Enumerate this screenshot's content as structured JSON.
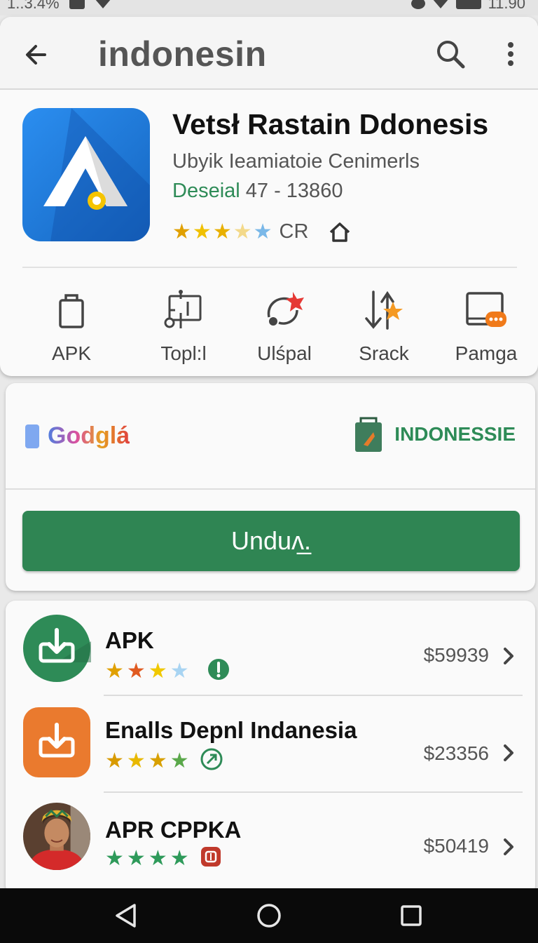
{
  "status_bar": {
    "left_text": "1..3.4%",
    "right_text": "11.90"
  },
  "app_bar": {
    "title": "indonesin"
  },
  "app": {
    "title": "Vetsł Rastain Ddonesis",
    "developer": "Ubyik Ieamiatoie Cenimerls",
    "meta_green": "Deseial",
    "meta_rest": " 47 - 13860",
    "rating_label": "CR",
    "icon_colors": {
      "start": "#2b8ef0",
      "end": "#1565c0"
    }
  },
  "actions": [
    {
      "label": "APK",
      "icon": "clipboard-icon"
    },
    {
      "label": "Topl:l",
      "icon": "circuit-icon"
    },
    {
      "label": "Ulśpal",
      "icon": "share-icon"
    },
    {
      "label": "Srack",
      "icon": "sort-star-icon"
    },
    {
      "label": "Pamga",
      "icon": "monitor-chat-icon"
    }
  ],
  "promo": {
    "brand_left": "Godglá",
    "brand_right": "INDONESSIE",
    "download_label": "Unduᴧ̲."
  },
  "list": [
    {
      "title": "APK",
      "price": "$59939",
      "icon": "download-icon",
      "icon_color": "#2e8b57",
      "badge_color": "#2e8b57"
    },
    {
      "title": "Enalls Depnl Indanesia",
      "price": "$23356",
      "icon": "download-icon",
      "icon_color": "#ea7a2e",
      "badge_color": "#2e8b57"
    },
    {
      "title": "APR CPPKA",
      "price": "$50419",
      "icon": "avatar-photo-icon",
      "icon_color": "#7a4a2a",
      "badge_color": "#c0392b"
    }
  ],
  "colors": {
    "accent_green": "#2f8553",
    "star_gold": "#e0a800",
    "star_blue": "#7ab8e8"
  }
}
